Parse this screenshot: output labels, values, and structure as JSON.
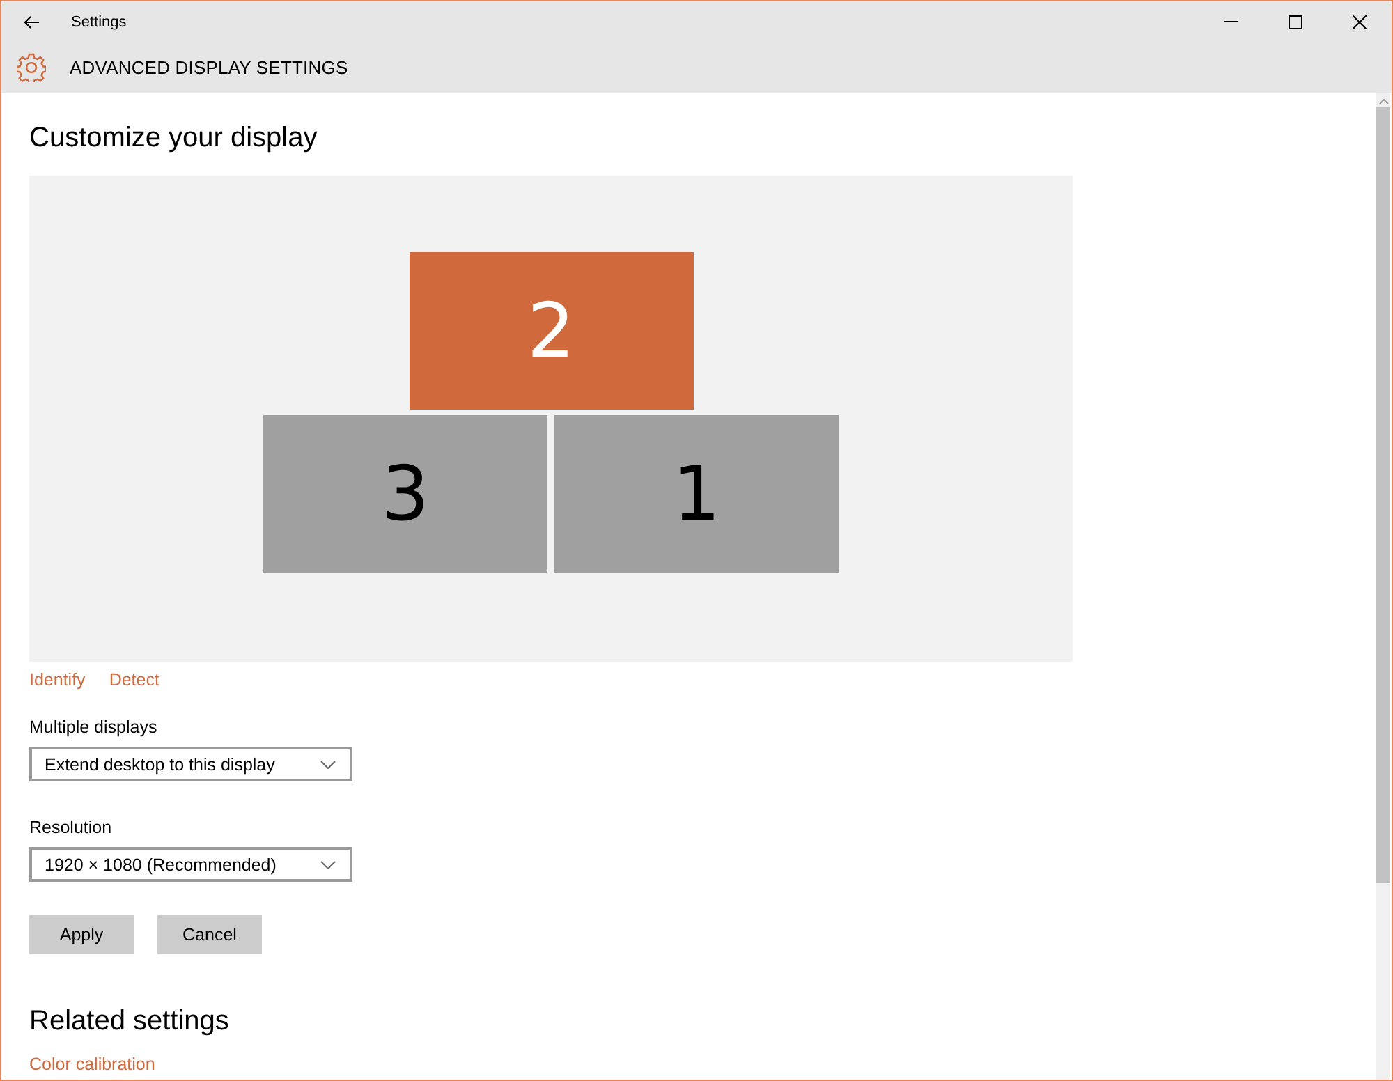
{
  "window": {
    "title": "Settings"
  },
  "header": {
    "title": "ADVANCED DISPLAY SETTINGS"
  },
  "section": {
    "heading": "Customize your display"
  },
  "arrangement": {
    "rows": [
      [
        {
          "label": "2",
          "selected": true
        }
      ],
      [
        {
          "label": "3",
          "selected": false
        },
        {
          "label": "1",
          "selected": false
        }
      ]
    ]
  },
  "links": [
    "Identify",
    "Detect"
  ],
  "fields": [
    {
      "label": "Multiple displays",
      "value": "Extend desktop to this display"
    },
    {
      "label": "Resolution",
      "value": "1920 × 1080 (Recommended)"
    }
  ],
  "buttons": [
    "Apply",
    "Cancel"
  ],
  "related": {
    "heading": "Related settings",
    "links": [
      "Color calibration"
    ]
  }
}
